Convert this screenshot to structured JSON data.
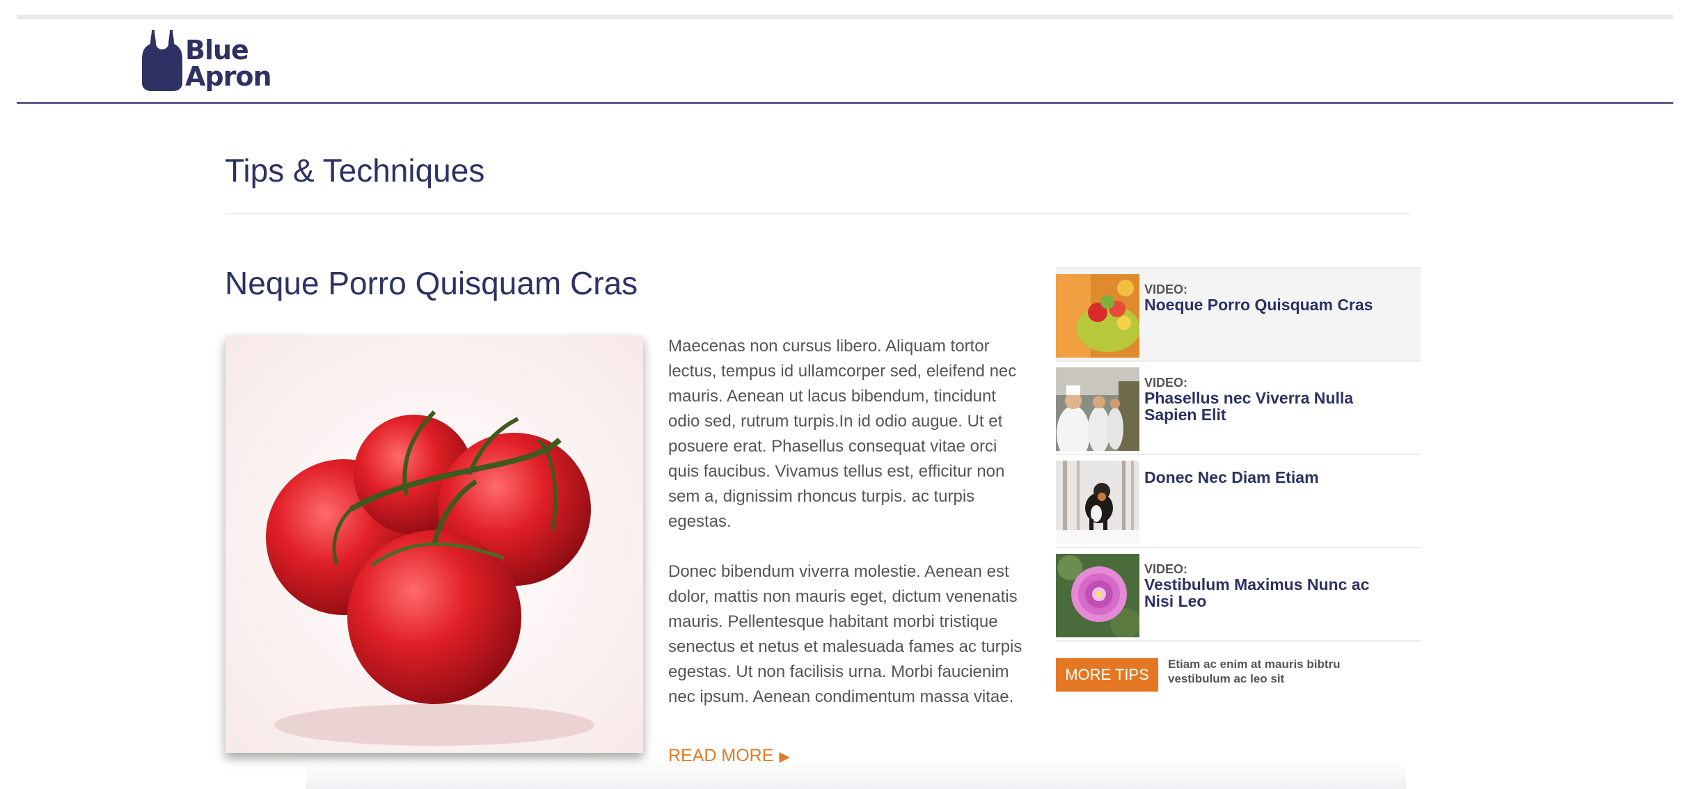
{
  "brand": {
    "line1": "Blue",
    "line2": "Apron",
    "color": "#2d3163"
  },
  "page": {
    "section_title": "Tips & Techniques"
  },
  "article": {
    "title": "Neque Porro Quisquam Cras",
    "paragraphs": [
      "Maecenas non cursus libero. Aliquam tortor lectus, tempus id ullamcorper sed, eleifend nec mauris. Aenean ut lacus bibendum, tincidunt odio sed, rutrum turpis.In id odio augue. Ut et posuere erat. Phasellus consequat vitae orci quis faucibus. Vivamus tellus est, efficitur non sem a, dignissim rhoncus turpis. ac turpis egestas.",
      "Donec bibendum viverra molestie. Aenean est dolor, mattis non mauris eget, dictum venenatis mauris. Pellentesque habitant morbi tristique senectus et netus et malesuada fames ac turpis egestas. Ut non facilisis urna. Morbi faucienim nec ipsum. Aenean condimentum massa vitae."
    ],
    "read_more": "READ MORE",
    "image_icon": "tomatoes-photo"
  },
  "sidebar": {
    "items": [
      {
        "kicker": "VIDEO:",
        "title": "Noeque Porro Quisquam Cras",
        "thumb": "fruit-bowl-photo"
      },
      {
        "kicker": "VIDEO:",
        "title": "Phasellus nec Viverra Nulla Sapien Elit",
        "thumb": "chefs-photo"
      },
      {
        "kicker": "",
        "title": "Donec Nec Diam Etiam",
        "thumb": "dog-in-snow-photo"
      },
      {
        "kicker": "VIDEO:",
        "title": "Vestibulum Maximus Nunc ac Nisi Leo",
        "thumb": "pink-dahlia-photo"
      }
    ],
    "more_tips": {
      "label": "MORE TIPS",
      "note": "Etiam ac enim at mauris bibtru vestibulum ac leo sit"
    }
  },
  "colors": {
    "accent": "#e57722",
    "heading": "#2d3163",
    "text": "#555555"
  }
}
